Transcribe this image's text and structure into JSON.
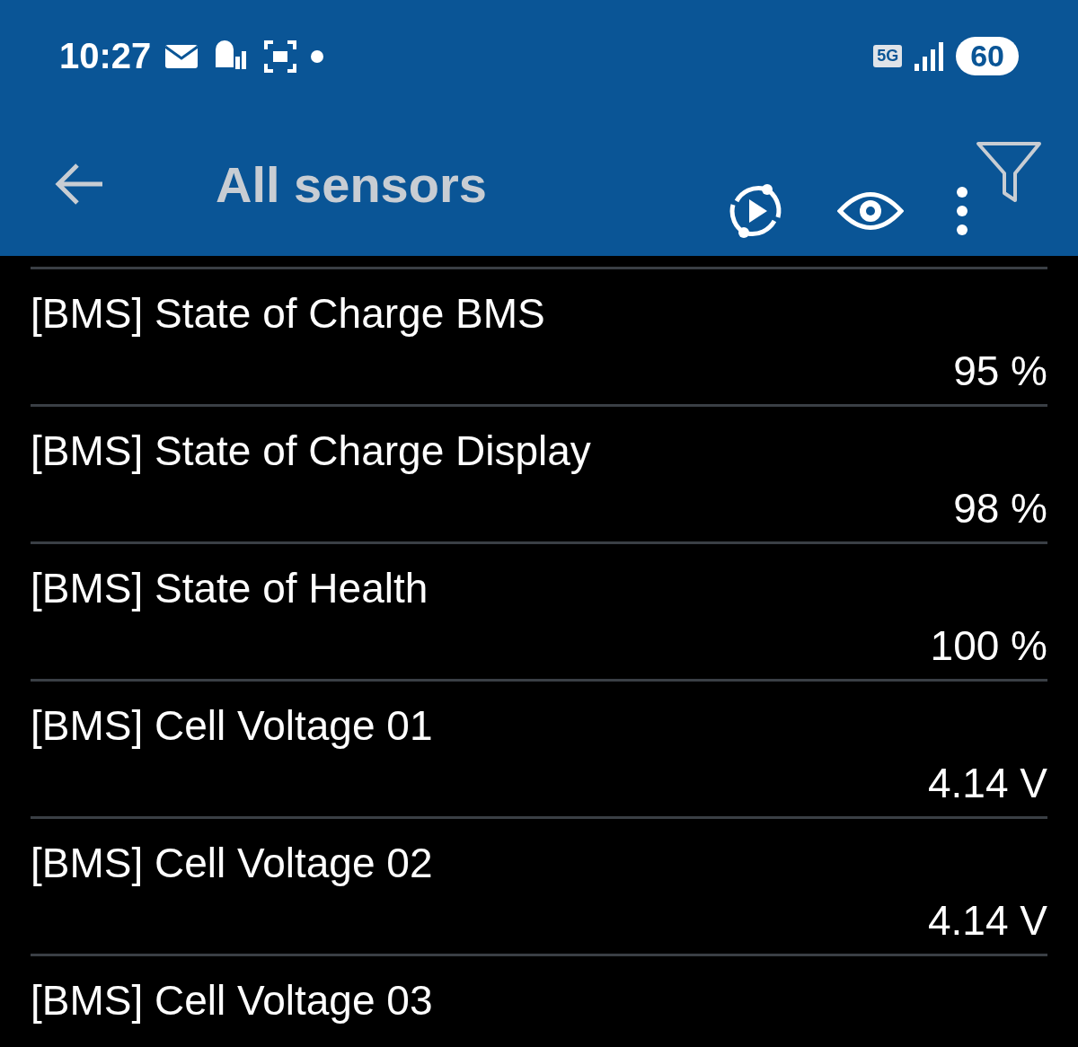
{
  "status_bar": {
    "time": "10:27",
    "network": "5G",
    "battery": "60"
  },
  "app_bar": {
    "title": "All sensors"
  },
  "sensors": [
    {
      "name": "[BMS] State of Charge BMS",
      "value": "95 %"
    },
    {
      "name": "[BMS] State of Charge Display",
      "value": "98 %"
    },
    {
      "name": "[BMS] State of Health",
      "value": "100 %"
    },
    {
      "name": "[BMS] Cell Voltage 01",
      "value": "4.14 V"
    },
    {
      "name": "[BMS] Cell Voltage 02",
      "value": "4.14 V"
    },
    {
      "name": "[BMS] Cell Voltage 03"
    }
  ]
}
